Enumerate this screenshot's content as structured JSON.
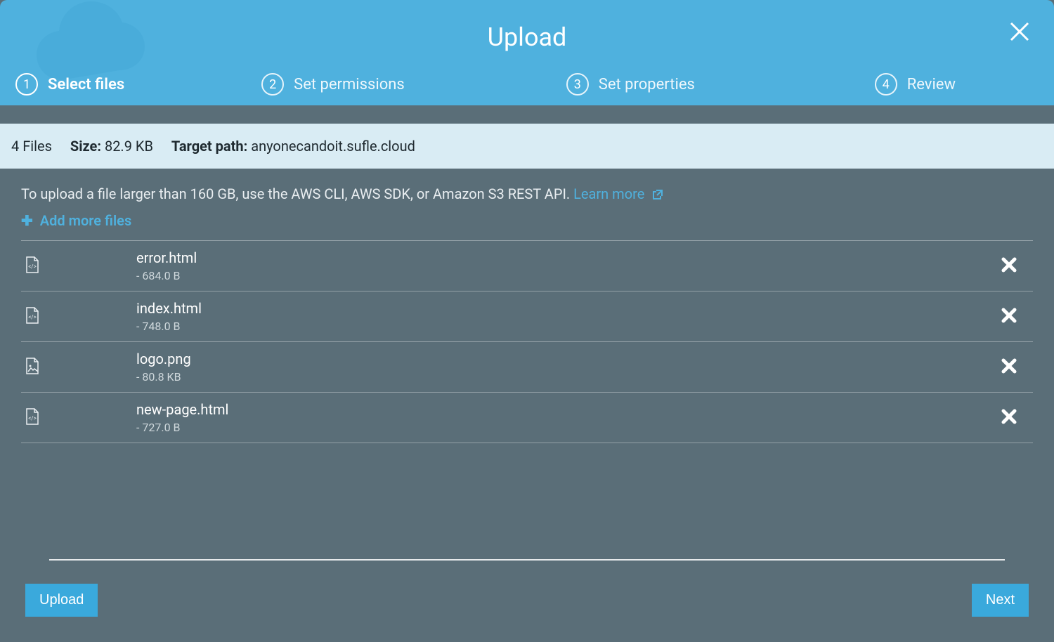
{
  "header": {
    "title": "Upload",
    "close_label": "Close"
  },
  "steps": [
    {
      "num": "1",
      "label": "Select files",
      "active": true
    },
    {
      "num": "2",
      "label": "Set permissions",
      "active": false
    },
    {
      "num": "3",
      "label": "Set properties",
      "active": false
    },
    {
      "num": "4",
      "label": "Review",
      "active": false
    }
  ],
  "summary": {
    "file_count": "4 Files",
    "size_label": "Size:",
    "size_value": "82.9 KB",
    "target_path_label": "Target path:",
    "target_path_value": "anyonecandoit.sufle.cloud"
  },
  "hint": {
    "text": "To upload a file larger than 160 GB, use the AWS CLI, AWS SDK, or Amazon S3 REST API. ",
    "learn_more": "Learn more"
  },
  "add_more_label": "Add more files",
  "files": [
    {
      "name": "error.html",
      "size": "- 684.0 B",
      "type": "code"
    },
    {
      "name": "index.html",
      "size": "- 748.0 B",
      "type": "code"
    },
    {
      "name": "logo.png",
      "size": "- 80.8 KB",
      "type": "image"
    },
    {
      "name": "new-page.html",
      "size": "- 727.0 B",
      "type": "code"
    }
  ],
  "buttons": {
    "upload": "Upload",
    "next": "Next"
  }
}
